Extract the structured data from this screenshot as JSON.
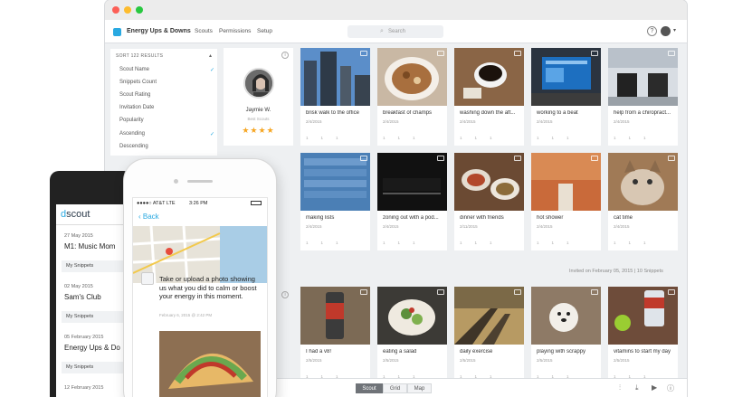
{
  "app": {
    "name": "Energy Ups & Downs",
    "nav": [
      "Scouts",
      "Permissions",
      "Setup"
    ],
    "search_placeholder": "Search",
    "help_icon": "question-circle-icon",
    "brand_color": "#29a9e1"
  },
  "sort": {
    "heading": "SORT 122 RESULTS",
    "items": [
      "Scout Name",
      "Snippets Count",
      "Scout Rating",
      "Invitation Date",
      "Popularity",
      "Ascending",
      "Descending"
    ],
    "checked": [
      "Scout Name",
      "Ascending"
    ]
  },
  "scout": {
    "name": "Jaymie W.",
    "tag": "Best Scouts",
    "stars": "★★★★"
  },
  "tiles_row1": [
    {
      "caption": "brisk walk to the office",
      "date": "2/4/2015"
    },
    {
      "caption": "breakfast of champs",
      "date": "2/4/2015"
    },
    {
      "caption": "washing down the aft...",
      "date": "2/4/2015"
    },
    {
      "caption": "working to a beat",
      "date": "2/4/2015"
    },
    {
      "caption": "help from a chiropract...",
      "date": "2/4/2015"
    }
  ],
  "tiles_row2": [
    {
      "caption": "making lists",
      "date": "2/4/2015"
    },
    {
      "caption": "zoning out with a pod...",
      "date": "2/4/2015"
    },
    {
      "caption": "dinner with friends",
      "date": "2/11/2015"
    },
    {
      "caption": "hot shower",
      "date": "2/4/2015"
    },
    {
      "caption": "cat time",
      "date": "2/4/2015"
    }
  ],
  "tiles_row3": [
    {
      "caption": "I had a v8!",
      "date": "2/5/2015"
    },
    {
      "caption": "eating a salad",
      "date": "2/5/2015"
    },
    {
      "caption": "daily exercise",
      "date": "2/5/2015"
    },
    {
      "caption": "playing with scrappy",
      "date": "2/5/2015"
    },
    {
      "caption": "vitamins to start my day",
      "date": "2/5/2015"
    }
  ],
  "tile_footer": {
    "a": "1",
    "b": "1",
    "c": "1"
  },
  "invited": "Invited on February 05, 2015  |  10 Snippets",
  "views": [
    "Scout",
    "Grid",
    "Map"
  ],
  "active_view": "Scout",
  "android": {
    "logo_d": "d",
    "logo_rest": "scout",
    "entries": [
      {
        "date": "27 May 2015",
        "title": "M1: Music Mom"
      },
      {
        "date": "02 May 2015",
        "title": "Sam's Club"
      },
      {
        "date": "05 February 2015",
        "title": "Energy Ups & Do"
      },
      {
        "date": "12 February 2015",
        "title": ""
      }
    ],
    "snippets_label": "My Snippets"
  },
  "iphone": {
    "carrier": "●●●●○ AT&T  LTE",
    "time": "3:26 PM",
    "back": "Back",
    "prompt": "Take or upload a photo showing us what you did to calm or boost your energy in this moment.",
    "prompt_date": "February 6, 2015 @ 2:42 PM"
  }
}
